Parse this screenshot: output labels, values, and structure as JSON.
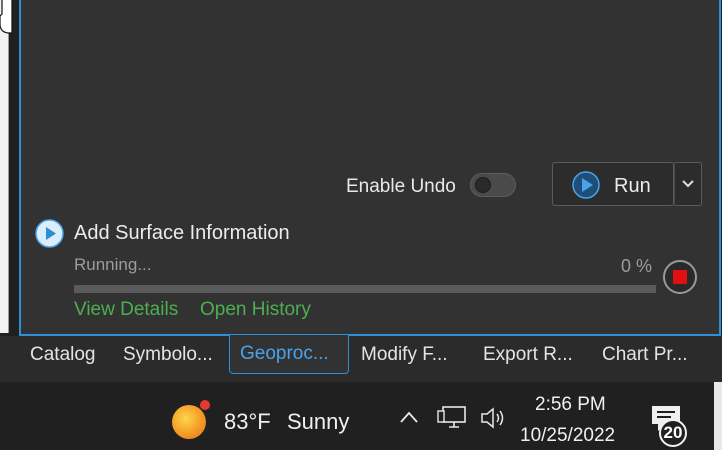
{
  "tool_pane": {
    "enable_undo_label": "Enable Undo",
    "enable_undo_on": false,
    "run_label": "Run"
  },
  "task": {
    "title": "Add Surface Information",
    "status": "Running...",
    "percent_text": "0 %",
    "progress": 0,
    "view_details": "View Details",
    "open_history": "Open History"
  },
  "tabs": [
    {
      "label": "Catalog",
      "active": false
    },
    {
      "label": "Symbolo...",
      "active": false
    },
    {
      "label": "Geoproc...",
      "active": true
    },
    {
      "label": "Modify F...",
      "active": false
    },
    {
      "label": "Export R...",
      "active": false
    },
    {
      "label": "Chart Pr...",
      "active": false
    }
  ],
  "taskbar": {
    "weather_temp": "83°F",
    "weather_condition": "Sunny",
    "time": "2:56 PM",
    "date": "10/25/2022",
    "notification_count": "20"
  },
  "colors": {
    "accent": "#2e8fd6",
    "link": "#4caf50",
    "stop": "#e01010"
  }
}
